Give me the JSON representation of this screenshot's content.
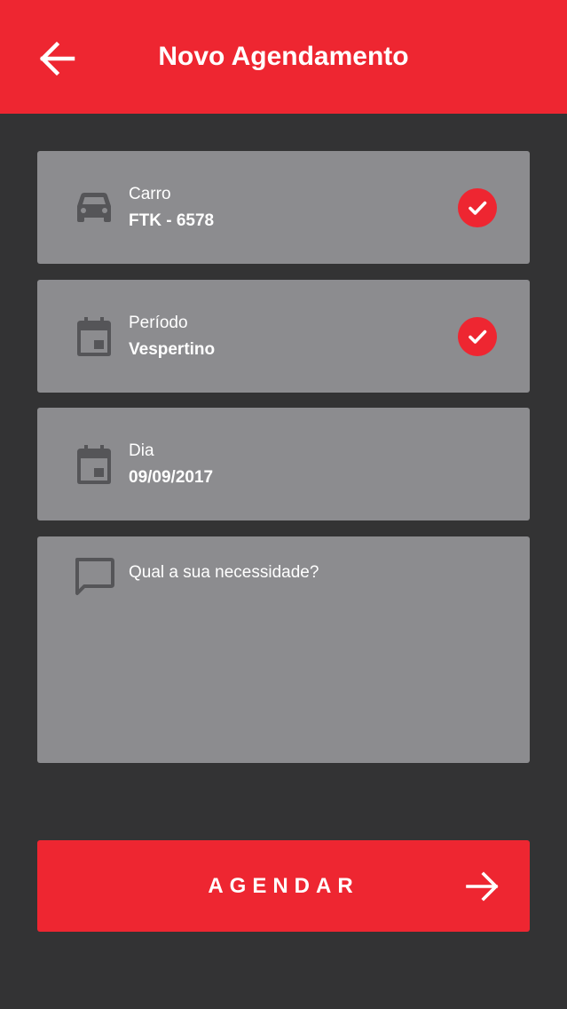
{
  "header": {
    "title": "Novo Agendamento",
    "back_icon": "arrow-left-icon"
  },
  "form": {
    "car": {
      "label": "Carro",
      "value": "FTK - 6578",
      "icon": "car-icon",
      "completed": true
    },
    "period": {
      "label": "Período",
      "value": "Vespertino",
      "icon": "calendar-icon",
      "completed": true
    },
    "day": {
      "label": "Dia",
      "value": "09/09/2017",
      "icon": "calendar-icon",
      "completed": false
    },
    "need": {
      "placeholder": "Qual a sua necessidade?",
      "value": "",
      "icon": "comment-icon"
    }
  },
  "submit": {
    "label": "AGENDAR",
    "icon": "arrow-right-icon"
  },
  "colors": {
    "accent": "#ee2631",
    "background": "#333334",
    "card": "#8c8c8f",
    "icon": "#555558"
  }
}
